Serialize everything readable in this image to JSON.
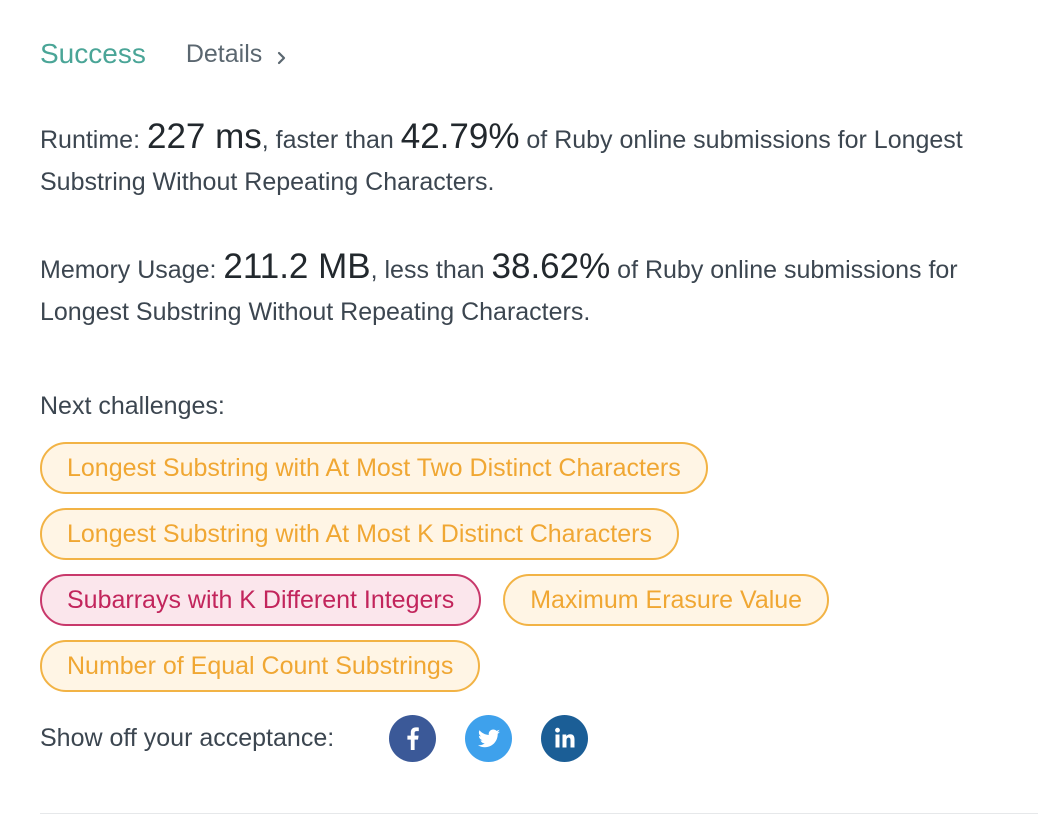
{
  "header": {
    "status": "Success",
    "details_label": "Details",
    "status_color": "#4aa597"
  },
  "runtime": {
    "label": "Runtime: ",
    "value": "227 ms",
    "mid": ", faster than ",
    "percent": "42.79%",
    "tail": " of Ruby online submissions for Longest Substring Without Repeating Characters."
  },
  "memory": {
    "label": "Memory Usage: ",
    "value": "211.2 MB",
    "mid": ", less than ",
    "percent": "38.62%",
    "tail": " of Ruby online submissions for Longest Substring Without Repeating Characters."
  },
  "next": {
    "label": "Next challenges:",
    "challenges": [
      {
        "title": "Longest Substring with At Most Two Distinct Characters",
        "difficulty": "medium"
      },
      {
        "title": "Longest Substring with At Most K Distinct Characters",
        "difficulty": "medium"
      },
      {
        "title": "Subarrays with K Different Integers",
        "difficulty": "hard"
      },
      {
        "title": "Maximum Erasure Value",
        "difficulty": "medium"
      },
      {
        "title": "Number of Equal Count Substrings",
        "difficulty": "medium"
      }
    ],
    "colors": {
      "medium": "#f0a733",
      "hard": "#c2255c"
    }
  },
  "share": {
    "label": "Show off your acceptance:",
    "networks": [
      {
        "icon": "facebook-icon",
        "color": "#3b5998"
      },
      {
        "icon": "twitter-icon",
        "color": "#3ea1ec"
      },
      {
        "icon": "linkedin-icon",
        "color": "#1b5e96"
      }
    ]
  }
}
